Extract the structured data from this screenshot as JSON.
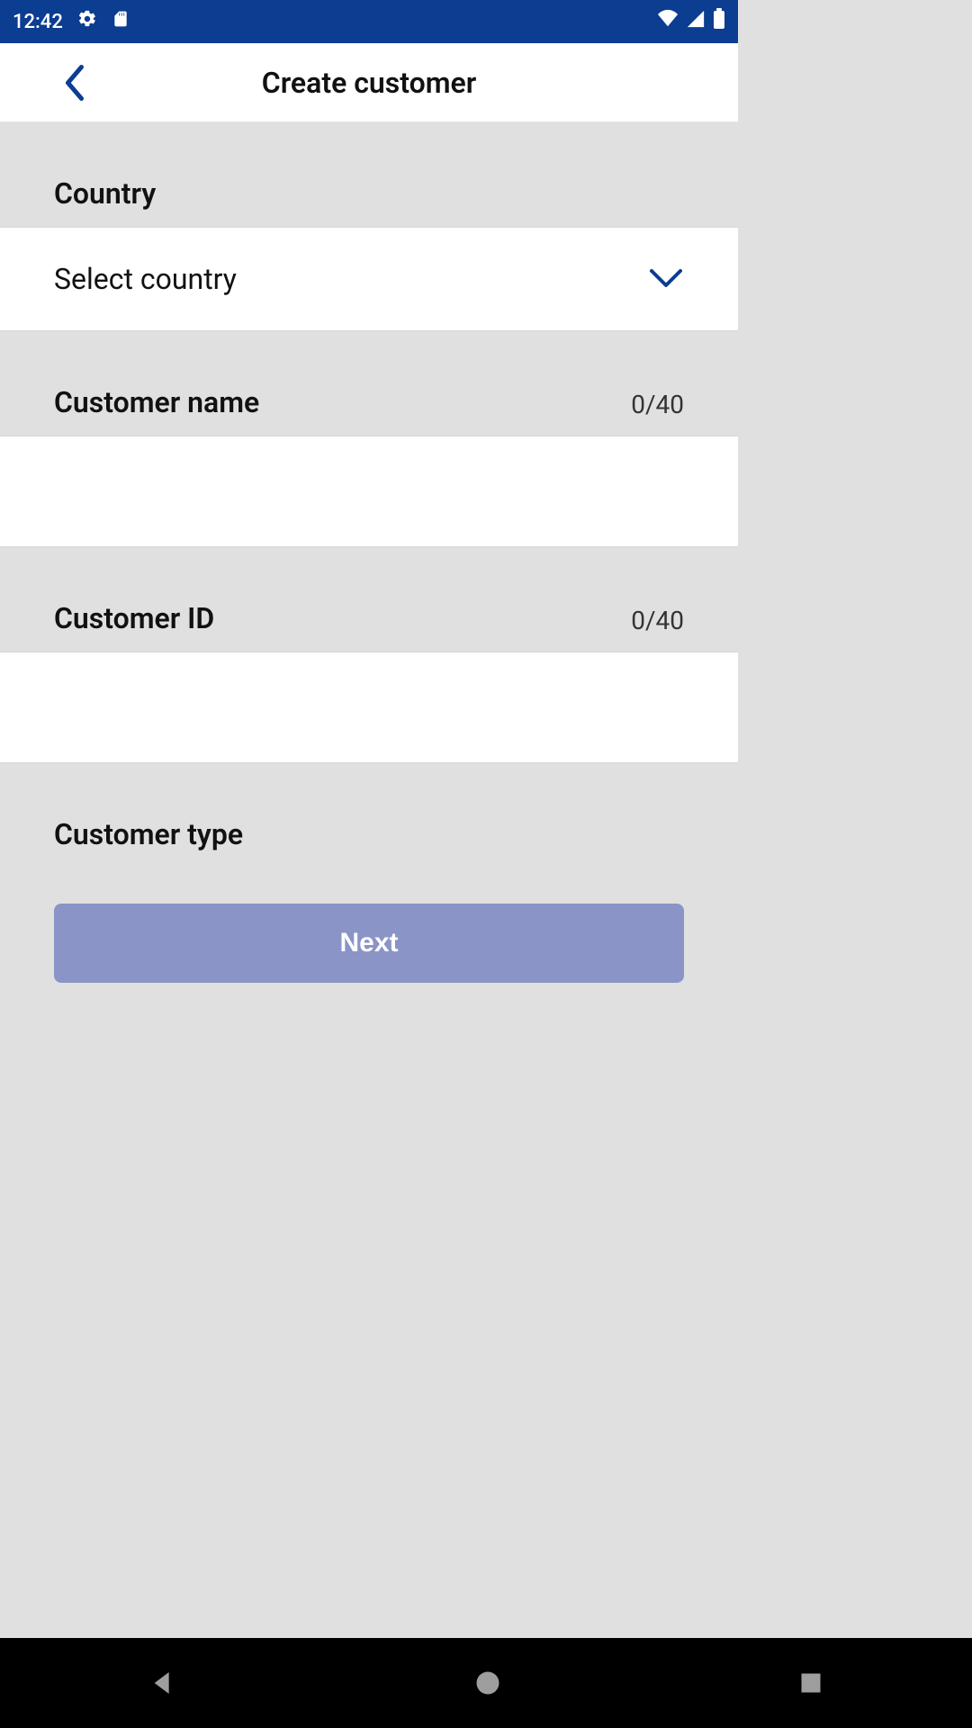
{
  "statusbar": {
    "time": "12:42"
  },
  "header": {
    "title": "Create customer"
  },
  "form": {
    "country": {
      "label": "Country",
      "select_text": "Select country"
    },
    "customer_name": {
      "label": "Customer name",
      "counter": "0/40",
      "value": ""
    },
    "customer_id": {
      "label": "Customer ID",
      "counter": "0/40",
      "value": ""
    },
    "customer_type": {
      "label": "Customer type"
    },
    "next_label": "Next"
  }
}
